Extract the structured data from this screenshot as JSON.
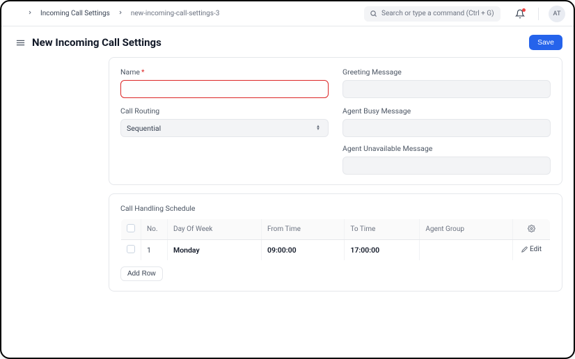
{
  "breadcrumb": {
    "parent": "Incoming Call Settings",
    "current": "new-incoming-call-settings-3"
  },
  "search": {
    "placeholder": "Search or type a command (Ctrl + G)"
  },
  "avatar": {
    "initials": "AT"
  },
  "header": {
    "title": "New Incoming Call Settings",
    "save_label": "Save"
  },
  "form": {
    "name_label": "Name",
    "name_value": "",
    "routing_label": "Call Routing",
    "routing_value": "Sequential",
    "greeting_label": "Greeting Message",
    "greeting_value": "",
    "busy_label": "Agent Busy Message",
    "busy_value": "",
    "unavail_label": "Agent Unavailable Message",
    "unavail_value": ""
  },
  "schedule": {
    "label": "Call Handling Schedule",
    "columns": {
      "no": "No.",
      "day": "Day Of Week",
      "from": "From Time",
      "to": "To Time",
      "group": "Agent Group"
    },
    "rows": [
      {
        "no": "1",
        "day": "Monday",
        "from": "09:00:00",
        "to": "17:00:00",
        "group": ""
      }
    ],
    "edit_label": "Edit",
    "add_row_label": "Add Row"
  }
}
